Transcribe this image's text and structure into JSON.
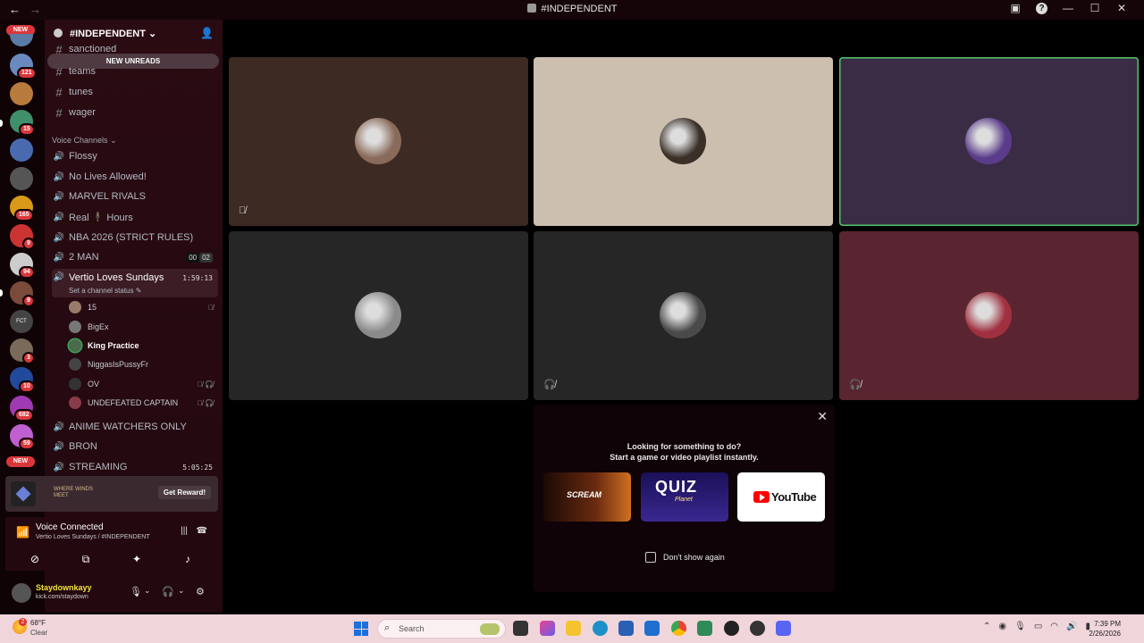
{
  "window": {
    "title": "#INDEPENDENT"
  },
  "rail": {
    "new_top": "NEW",
    "new_bottom": "NEW",
    "badges": [
      "121",
      "15",
      "165",
      "9",
      "94",
      "9",
      "3",
      "10",
      "682",
      "59",
      "23"
    ],
    "overlay_text": "FCT",
    "colors": [
      "#5a7ba6",
      "#b87a3d",
      "#3f8f6a",
      "#4a6ab0",
      "#555",
      "#d99a1a",
      "#c33",
      "#ccc",
      "#7a4a3a",
      "#444",
      "#7a6a5a",
      "#224a9c",
      "#a03ab0",
      "#c060d0"
    ]
  },
  "server": {
    "name": "#INDEPENDENT",
    "new_unreads": "NEW UNREADS",
    "partial_channel": "sanctioned",
    "text_channels": [
      "teams",
      "tunes",
      "wager"
    ],
    "voice_category": "Voice Channels",
    "voice_channels": [
      {
        "name": "Flossy"
      },
      {
        "name": "No Lives Allowed!"
      },
      {
        "name": "MARVEL RIVALS"
      },
      {
        "name": "Real 🕴 Hours"
      },
      {
        "name": "NBA 2026 (STRICT RULES)"
      },
      {
        "name": "2 MAN",
        "counter": [
          "00",
          "02"
        ]
      }
    ],
    "active_channel": {
      "name": "Vertio Loves Sundays",
      "time": "1:59:13",
      "status": "Set a channel status"
    },
    "members": [
      {
        "name": "15",
        "muted": true
      },
      {
        "name": "BigEx",
        "muted": false
      },
      {
        "name": "King Practice",
        "muted": false,
        "speaking": true
      },
      {
        "name": "NiggasIsPussyFr",
        "muted": false
      },
      {
        "name": "OV",
        "muted": true
      },
      {
        "name": "UNDEFEATED CAPTAIN",
        "muted": true
      }
    ],
    "more_channels": [
      {
        "name": "ANIME WATCHERS ONLY"
      },
      {
        "name": "BRON"
      },
      {
        "name": "STREAMING",
        "time": "5:05:25"
      }
    ]
  },
  "reward": {
    "game_text": "WHERE WINDS MEET",
    "button": "Get Reward!"
  },
  "voice": {
    "title": "Voice Connected",
    "subtitle": "Vertio Loves Sundays / #INDEPENDENT"
  },
  "user": {
    "name": "Staydownkayy",
    "status": "kick.com/staydown"
  },
  "tiles": [
    {
      "bg": "#3d2a22",
      "avatar": "#8a6a5a",
      "muted": true,
      "speaking": false
    },
    {
      "bg": "#cdbfb0",
      "avatar": "#3a3028",
      "muted": false,
      "speaking": false
    },
    {
      "bg": "#3a2c44",
      "avatar": "#5a3c8a",
      "muted": false,
      "speaking": true
    },
    {
      "bg": "#262626",
      "avatar": "#8a8a8a",
      "muted": false,
      "speaking": false
    },
    {
      "bg": "#262626",
      "avatar": "#4a4a4a",
      "muted": true,
      "speaking": false
    },
    {
      "bg": "#5a2530",
      "avatar": "#a03040",
      "muted": true,
      "speaking": false
    }
  ],
  "popup": {
    "line1": "Looking for something to do?",
    "line2": "Start a game or video playlist instantly.",
    "activities": [
      "SCREAM",
      "QUIZ",
      "Planet",
      "YouTube"
    ],
    "checkbox_label": "Don't show again"
  },
  "taskbar": {
    "temp": "68°F",
    "condition": "Clear",
    "weather_badge": "2",
    "search": "Search",
    "time": "7:39 PM",
    "date": "2/26/2026"
  }
}
